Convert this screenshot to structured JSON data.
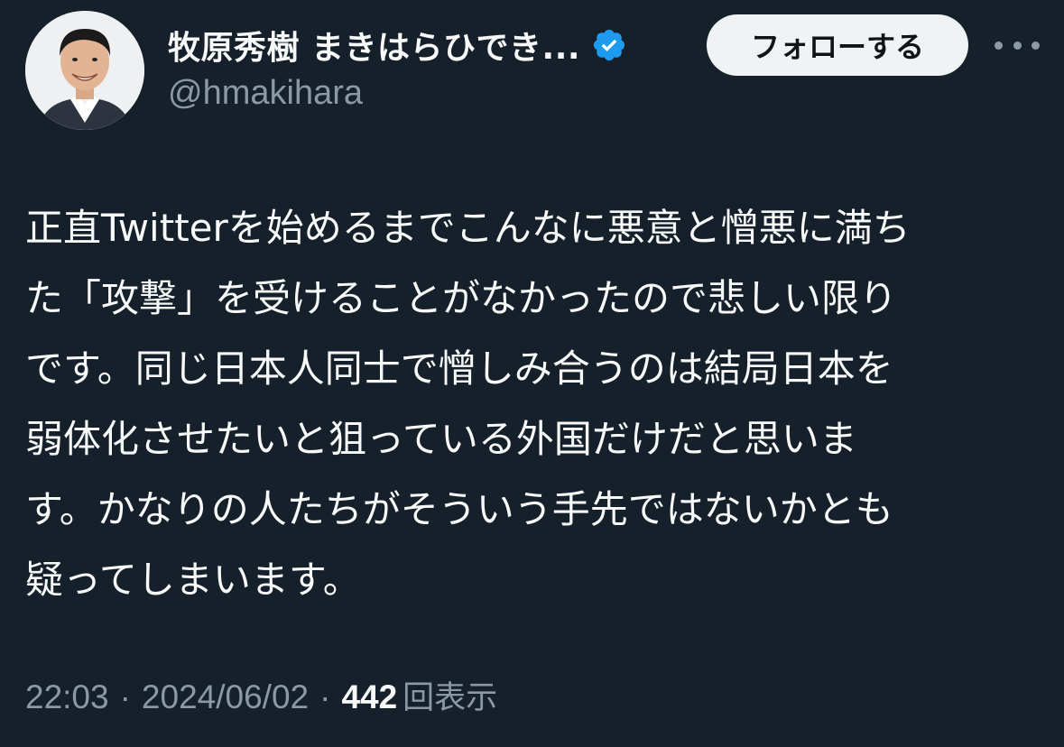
{
  "author": {
    "display_name": "牧原秀樹 まきはらひでき...",
    "handle": "@hmakihara",
    "verified_icon": "verified-badge-icon",
    "avatar": "profile-photo"
  },
  "actions": {
    "follow_label": "フォローする",
    "more_icon": "more-options-icon"
  },
  "tweet": {
    "lines": [
      "正直Twitterを始めるまでこんなに悪意と憎悪に満ち",
      "た「攻撃」を受けることがなかったので悲しい限り",
      "です。同じ日本人同士で憎しみ合うのは結局日本を",
      "弱体化させたいと狙っている外国だけだと思いま",
      "す。かなりの人たちがそういう手先ではないかとも",
      "疑ってしまいます。"
    ]
  },
  "meta": {
    "time": "22:03",
    "separator": "·",
    "date": "2024/06/02",
    "views_count": "442",
    "views_label": "回表示"
  },
  "colors": {
    "background": "#15202b",
    "text_primary": "#f7f9f9",
    "text_secondary": "#8b98a5",
    "verified_blue": "#1d9bf0",
    "follow_button_bg": "#eff3f4"
  }
}
